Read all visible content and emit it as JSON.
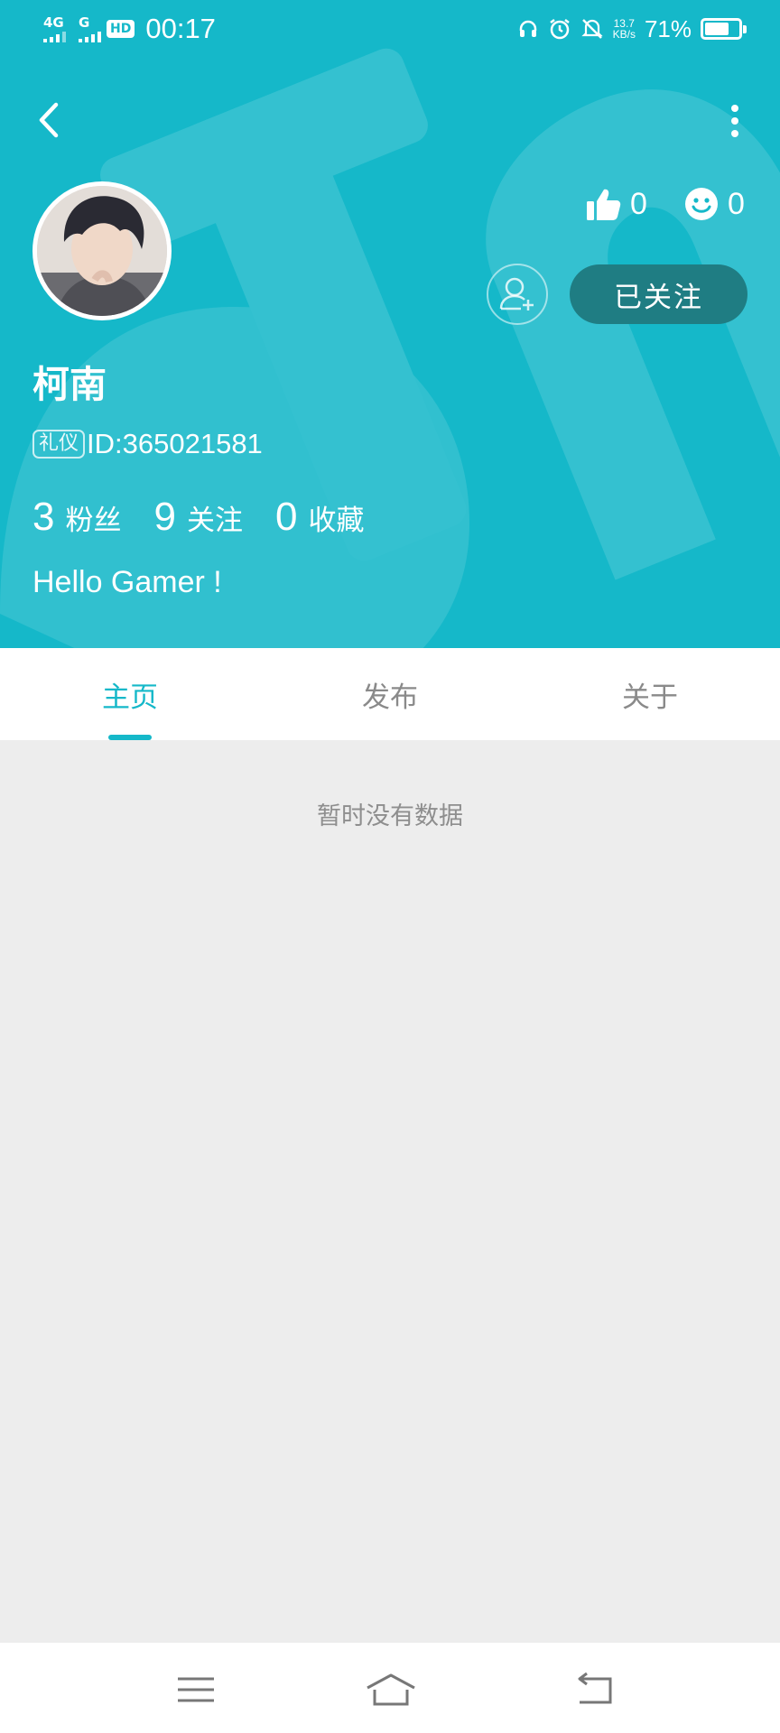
{
  "status_bar": {
    "net1": "4G",
    "net2": "G",
    "hd": "HD",
    "time": "00:17",
    "speed_value": "13.7",
    "speed_unit": "KB/s",
    "battery": "71%",
    "battery_level": 0.71
  },
  "profile": {
    "name": "柯南",
    "badge": "礼仪",
    "id_label": "ID:365021581",
    "likes": "0",
    "smiles": "0",
    "follow_label": "已关注",
    "bio": "Hello Gamer !",
    "stats": [
      {
        "num": "3",
        "label": "粉丝"
      },
      {
        "num": "9",
        "label": "关注"
      },
      {
        "num": "0",
        "label": "收藏"
      }
    ]
  },
  "tabs": [
    {
      "label": "主页",
      "active": true
    },
    {
      "label": "发布",
      "active": false
    },
    {
      "label": "关于",
      "active": false
    }
  ],
  "empty_text": "暂时没有数据",
  "colors": {
    "brand": "#15B8C9",
    "follow_button": "#1F7D83",
    "content_bg": "#EDEDED"
  },
  "icons": [
    "back-arrow-icon",
    "more-vertical-icon",
    "thumbs-up-icon",
    "smile-icon",
    "add-friend-icon",
    "menu-icon",
    "home-icon",
    "back-icon"
  ]
}
